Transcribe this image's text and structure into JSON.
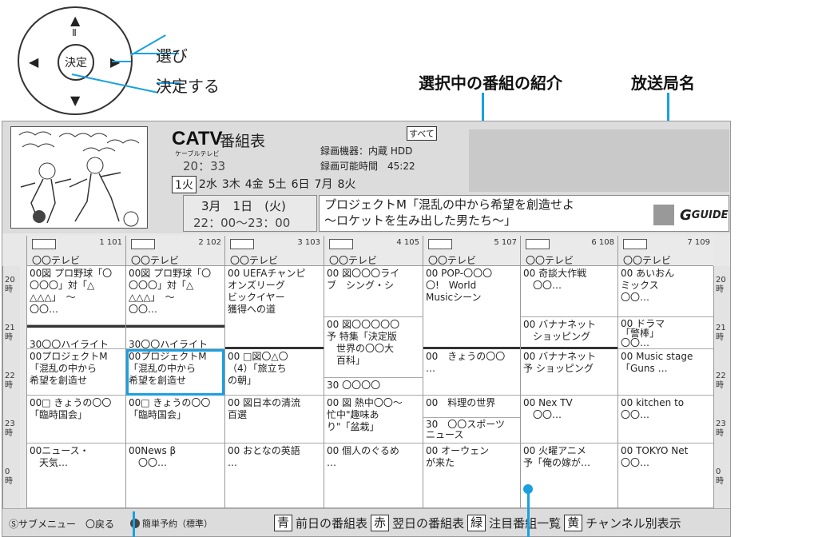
{
  "remote": {
    "arrow_up": "▲",
    "arrow_down": "▼",
    "arrow_left": "◀",
    "arrow_right": "▶",
    "pause_symbol": "Ⅱ",
    "center_label": "決定"
  },
  "callouts": {
    "select": "選び",
    "confirm": "決定する",
    "program_intro": "選択中の番組の紹介",
    "station_name": "放送局名"
  },
  "header": {
    "brand": "CATV",
    "title": "番組表",
    "sub_brand": "ケーブルテレビ",
    "clock": "20：33",
    "all_badge": "すべて",
    "recorder": "録画機器：内蔵 HDD",
    "record_time": "録画可能時間　45:22",
    "days": [
      "1火",
      "2水",
      "3木",
      "4金",
      "5土",
      "6日",
      "7月",
      "8火"
    ],
    "selected_date": "3月　1日　(火)",
    "selected_time": "22：00〜23：00",
    "selected_program": "プロジェクトM「混乱の中から希望を創造せよ\n〜ロケットを生み出した男たち〜」",
    "guide_logo": "GUIDE"
  },
  "time_labels": [
    "20\n時",
    "21\n時",
    "22\n時",
    "23\n時",
    "0\n時"
  ],
  "channels": [
    {
      "num": "1 101",
      "name": "〇〇テレビ",
      "programs": [
        {
          "text": "00図 プロ野球「〇\n〇〇〇」対「△\n△△△」　〜\n〇〇…"
        },
        {
          "text": "30〇〇ハイライト"
        },
        {
          "text": "00プロジェクトM\n「混乱の中から\n希望を創造せ"
        },
        {
          "text": "00□ きょうの〇〇\n「臨時国会」"
        },
        {
          "text": "00ニュース・\n　天気…"
        }
      ]
    },
    {
      "num": "2 102",
      "name": "〇〇テレビ",
      "programs": [
        {
          "text": "00図 プロ野球「〇\n〇〇〇」対「△\n△△△」　〜\n〇〇…"
        },
        {
          "text": "30〇〇ハイライト"
        },
        {
          "text": "00プロジェクトM\n「混乱の中から\n希望を創造せ"
        },
        {
          "text": "00□ きょうの〇〇\n「臨時国会」"
        },
        {
          "text": "00News β\n　〇〇…"
        }
      ]
    },
    {
      "num": "3 103",
      "name": "〇〇テレビ",
      "programs": [
        {
          "text": "00 UEFAチャンピ\nオンズリーグ\nビックイヤー\n獲得への道"
        },
        {
          "text": "00 □図〇△〇\n（4）「旅立ち\nの朝」"
        },
        {
          "text": "00 図日本の清流\n百選"
        },
        {
          "text": "00 おとなの英語\n…"
        }
      ]
    },
    {
      "num": "4 105",
      "name": "〇〇テレビ",
      "programs": [
        {
          "text": "00 図〇〇〇ライ\nブ　シング・シ"
        },
        {
          "text": "00 図〇〇〇〇〇\n予 特集「決定版\n　世界の〇〇大\n　百科」"
        },
        {
          "text": "30 〇〇〇〇"
        },
        {
          "text": "00 図 熱中〇〇〜\n忙中\"趣味あ\nり\"「盆栽」"
        },
        {
          "text": "00 個人のぐるめ\n…"
        }
      ]
    },
    {
      "num": "5 107",
      "name": "〇〇テレビ",
      "programs": [
        {
          "text": "00 POP-〇〇〇\n〇!　World\nMusicシーン"
        },
        {
          "text": "00　きょうの〇〇\n…"
        },
        {
          "text": "00　料理の世界"
        },
        {
          "text": "30　〇〇スポーツ\nニュース"
        },
        {
          "text": "00 オーウェン\nが来た"
        }
      ]
    },
    {
      "num": "6 108",
      "name": "〇〇テレビ",
      "programs": [
        {
          "text": "00 奇談大作戦\n　〇〇…"
        },
        {
          "text": "00 バナナネット\n　ショッピング"
        },
        {
          "text": "00 バナナネット\n予 ショッピング"
        },
        {
          "text": "00 Nex TV\n　〇〇…"
        },
        {
          "text": "00 火曜アニメ\n予「俺の嫁が…"
        }
      ]
    },
    {
      "num": "7 109",
      "name": "〇〇テレビ",
      "programs": [
        {
          "text": "00 あいおん\nミックス\n〇〇…"
        },
        {
          "text": "00 ドラマ\n「警棒」\n〇〇…"
        },
        {
          "text": "00 Music stage\n「Guns …"
        },
        {
          "text": "00 kitchen to\n〇〇…"
        },
        {
          "text": "00 TOKYO Net\n〇〇…"
        }
      ]
    }
  ],
  "footer": {
    "submenu": "Ⓢサブメニュー　〇戻る",
    "easy_rec": "簡単予約（標準）",
    "blue_key": "青",
    "blue_label": "前日の番組表",
    "red_key": "赤",
    "red_label": "翌日の番組表",
    "green_key": "緑",
    "green_label": "注目番組一覧",
    "yellow_key": "黄",
    "yellow_label": "チャンネル別表示"
  }
}
